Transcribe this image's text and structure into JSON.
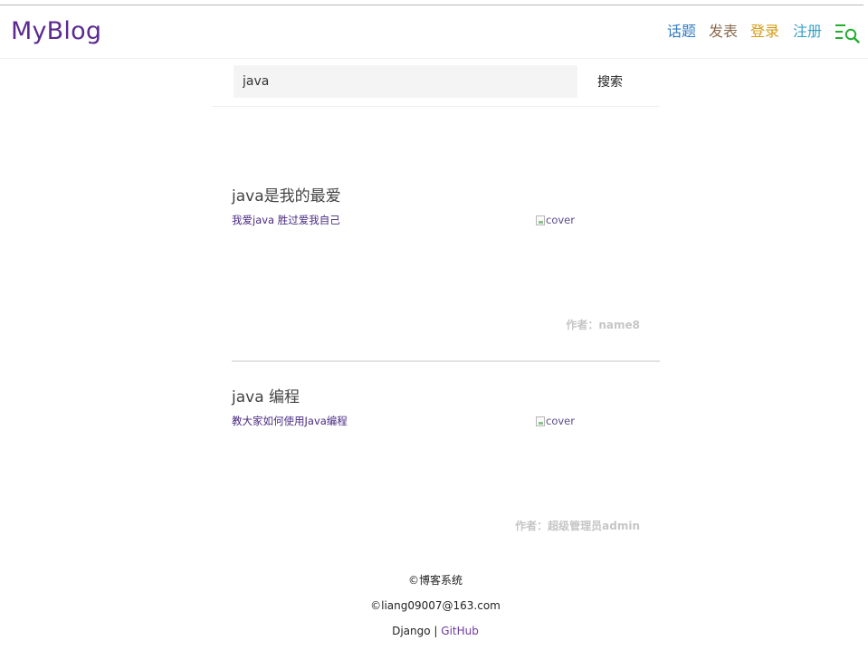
{
  "navbar": {
    "brand": "MyBlog",
    "links": {
      "topics": "话题",
      "post": "发表",
      "login": "登录",
      "register": "注册"
    },
    "search_icon": "search-toggle-icon",
    "colors": {
      "brand": "#5b2a91",
      "topics": "#2f7bc2",
      "post": "#8a6a4e",
      "login": "#d49b14",
      "register": "#3aa0c8",
      "search_icon": "#1fae2e"
    }
  },
  "search": {
    "value": "java",
    "button_label": "搜索"
  },
  "posts": [
    {
      "title": "java是我的最爱",
      "summary": "我爱java 胜过爱我自己",
      "cover_alt": "cover",
      "author": "作者：name8"
    },
    {
      "title": "java 编程",
      "summary": "教大家如何使用Java编程",
      "cover_alt": "cover",
      "author": "作者：超级管理员admin"
    }
  ],
  "footer": {
    "copyright": "©博客系统",
    "email": "©liang09007@163.com",
    "framework": "Django",
    "separator": " | ",
    "github": "GitHub"
  }
}
